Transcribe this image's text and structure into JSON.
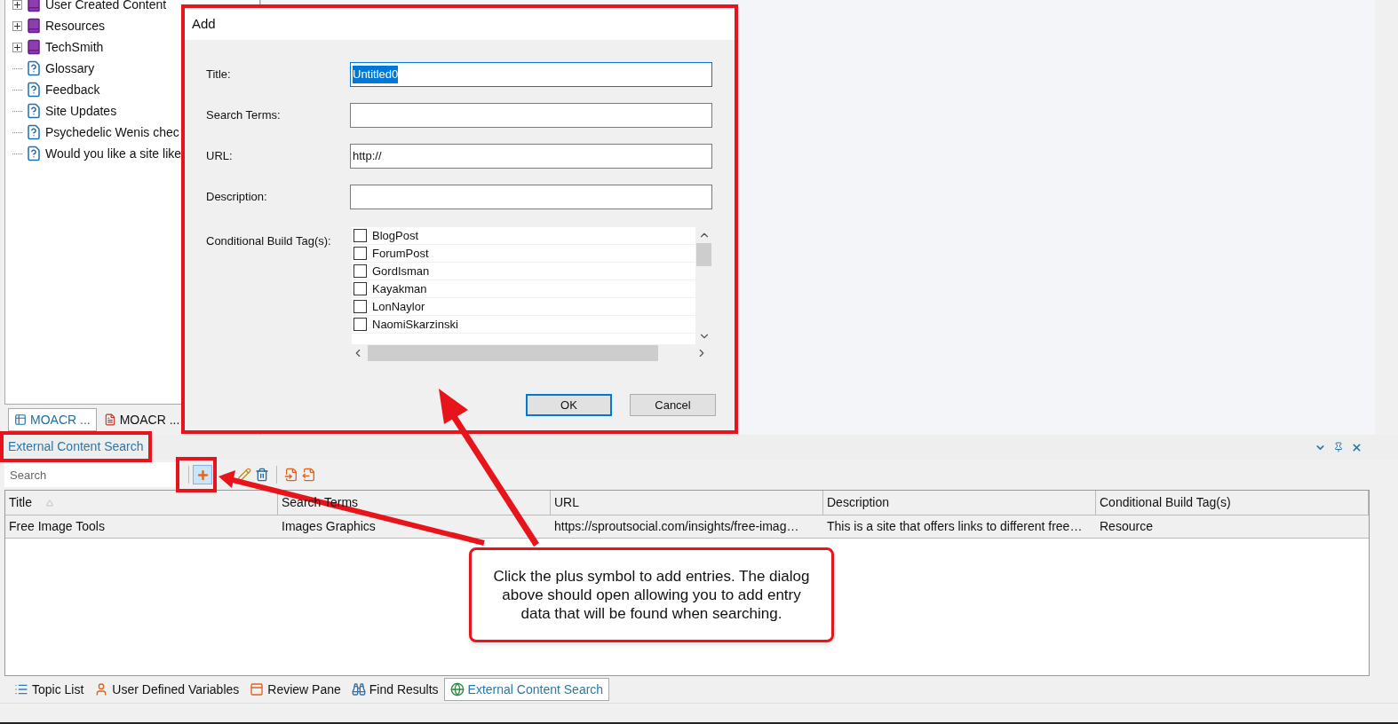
{
  "tree": {
    "items": [
      {
        "label": "User Created Content",
        "kind": "book",
        "expanded": false
      },
      {
        "label": "Resources",
        "kind": "book",
        "expanded": false
      },
      {
        "label": "TechSmith",
        "kind": "book",
        "expanded": false
      },
      {
        "label": "Glossary",
        "kind": "topic"
      },
      {
        "label": "Feedback",
        "kind": "topic"
      },
      {
        "label": "Site Updates",
        "kind": "topic"
      },
      {
        "label": "Psychedelic Wenis chec",
        "kind": "topic"
      },
      {
        "label": "Would you like a site like",
        "kind": "topic"
      }
    ]
  },
  "left_tabs": [
    {
      "label": "MOACR ...",
      "selected": true
    },
    {
      "label": "MOACR ...",
      "selected": false
    }
  ],
  "dialog": {
    "title": "Add",
    "fields": [
      {
        "label": "Title:",
        "value": "Untitled0",
        "selected": true
      },
      {
        "label": "Search Terms:"
      },
      {
        "label": "URL:",
        "value": "http://",
        "selected": false
      },
      {
        "label": "Description:"
      }
    ],
    "tags_label": "Conditional Build Tag(s):",
    "tags": [
      {
        "label": "BlogPost",
        "checked": false
      },
      {
        "label": "ForumPost",
        "checked": false
      },
      {
        "label": "GordIsman",
        "checked": false
      },
      {
        "label": "Kayakman",
        "checked": false
      },
      {
        "label": "LonNaylor",
        "checked": false
      },
      {
        "label": "NaomiSkarzinski",
        "checked": false
      }
    ],
    "buttons": [
      {
        "label": "OK",
        "default": true
      },
      {
        "label": "Cancel",
        "default": false
      }
    ]
  },
  "panel": {
    "title": "External Content Search",
    "search": {
      "placeholder": "Search"
    },
    "columns": [
      {
        "label": "Title",
        "sorted": true
      },
      {
        "label": "Search Terms",
        "sorted": false
      },
      {
        "label": "URL",
        "sorted": false
      },
      {
        "label": "Description",
        "sorted": false
      },
      {
        "label": "Conditional Build Tag(s)",
        "sorted": false
      }
    ],
    "rows": [
      [
        "Free Image Tools",
        "Images Graphics",
        "https://sproutsocial.com/insights/free-imag…",
        "This is a site that offers links to different free…",
        "Resource"
      ]
    ]
  },
  "bottom_tabs": [
    {
      "label": "Topic List",
      "selected": false
    },
    {
      "label": "User Defined Variables",
      "selected": false
    },
    {
      "label": "Review Pane",
      "selected": false
    },
    {
      "label": "Find Results",
      "selected": false
    },
    {
      "label": "External Content Search",
      "selected": true
    }
  ],
  "callout": {
    "text": "Click the plus symbol to add entries. The dialog above should open allowing you to add entry data that will be found when searching."
  }
}
